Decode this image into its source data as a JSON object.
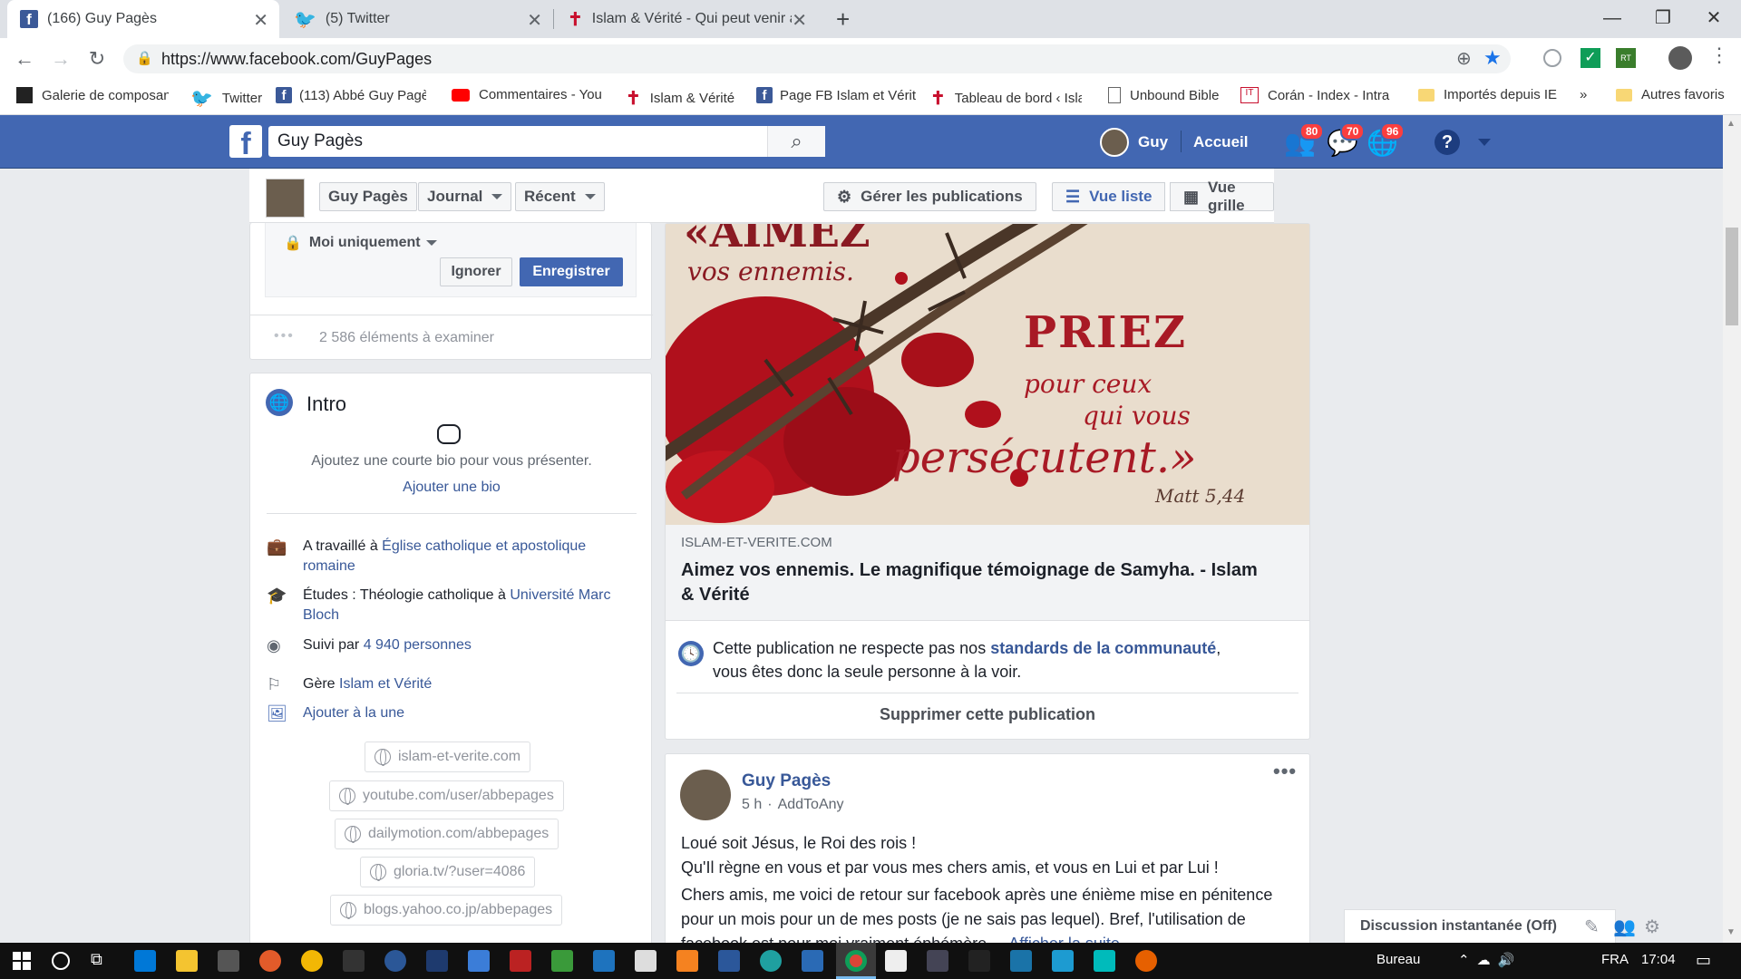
{
  "browser": {
    "tabs": [
      {
        "title": "(166) Guy Pagès",
        "icon": "facebook-icon"
      },
      {
        "title": "(5) Twitter",
        "icon": "twitter-icon"
      },
      {
        "title": "Islam & Vérité - Qui peut venir ap",
        "icon": "cross-icon"
      }
    ],
    "url": "https://www.facebook.com/GuyPages",
    "bookmarks": [
      "Galerie de composan",
      "Twitter",
      "(113) Abbé Guy Pagè",
      "Commentaires - You",
      "Islam & Vérité",
      "Page FB Islam et Vérit",
      "Tableau de bord ‹ Isla",
      "Unbound Bible",
      "Corán - Index - Intra",
      "Importés depuis IE",
      "»",
      "Autres favoris"
    ]
  },
  "fb_header": {
    "search_value": "Guy Pagès",
    "user_name": "Guy",
    "home_label": "Accueil",
    "badges": {
      "friends": "80",
      "messages": "70",
      "notifications": "96"
    }
  },
  "subnav": {
    "name": "Guy Pagès",
    "journal": "Journal",
    "recent": "Récent",
    "manage": "Gérer les publications",
    "list_view": "Vue liste",
    "grid_view": "Vue grille"
  },
  "privacy": {
    "audience": "Moi uniquement",
    "ignore": "Ignorer",
    "save": "Enregistrer",
    "review_count": "2 586 éléments à examiner"
  },
  "intro": {
    "title": "Intro",
    "bio_prompt": "Ajoutez une courte bio pour vous présenter.",
    "add_bio": "Ajouter une bio",
    "work_prefix": "A travaillé à ",
    "work_link": "Église catholique et apostolique romaine",
    "study_prefix": "Études : Théologie catholique à ",
    "study_link": "Université Marc Bloch",
    "follow_prefix": "Suivi par ",
    "follow_link": "4 940 personnes",
    "manage_prefix": "Gère ",
    "manage_link": "Islam et Vérité",
    "featured": "Ajouter à la une",
    "links": [
      "islam-et-verite.com",
      "youtube.com/user/abbepages",
      "dailymotion.com/abbepages",
      "gloria.tv/?user=4086",
      "blogs.yahoo.co.jp/abbepages"
    ]
  },
  "post1": {
    "image_text": {
      "line1": "«AIMEZ",
      "line2": "vos ennemis.",
      "line3": "PRIEZ",
      "line4": "pour ceux",
      "line5": "qui vous",
      "line6": "persécutent.»",
      "ref": "Matt 5,44"
    },
    "domain": "ISLAM-ET-VERITE.COM",
    "title": "Aimez vos ennemis. Le magnifique témoignage de Samyha. - Islam & Vérité",
    "notice_prefix": "Cette publication ne respecte pas nos ",
    "notice_link": "standards de la communauté",
    "notice_suffix": ",",
    "notice_line2": "vous êtes donc la seule personne à la voir.",
    "delete": "Supprimer cette publication"
  },
  "post2": {
    "author": "Guy Pagès",
    "time": "5 h",
    "app": "AddToAny",
    "line1": "Loué soit Jésus, le Roi des rois !",
    "line2": "Qu'Il règne en vous et par vous mes chers amis, et vous en Lui et par Lui !",
    "para": "Chers amis, me voici de retour sur facebook après une énième mise en pénitence pour un mois pour un de mes posts (je ne sais pas lequel). Bref, l'utilisation de facebook est pour moi vraiment éphémère ...",
    "more": "Afficher la suite"
  },
  "chat": {
    "label": "Discussion instantanée (Off)"
  },
  "taskbar": {
    "desktop": "Bureau",
    "lang": "FRA",
    "time": "17:04"
  },
  "colors": {
    "fb_blue": "#4267b2",
    "link": "#385898",
    "badge_red": "#fa3e3e"
  }
}
